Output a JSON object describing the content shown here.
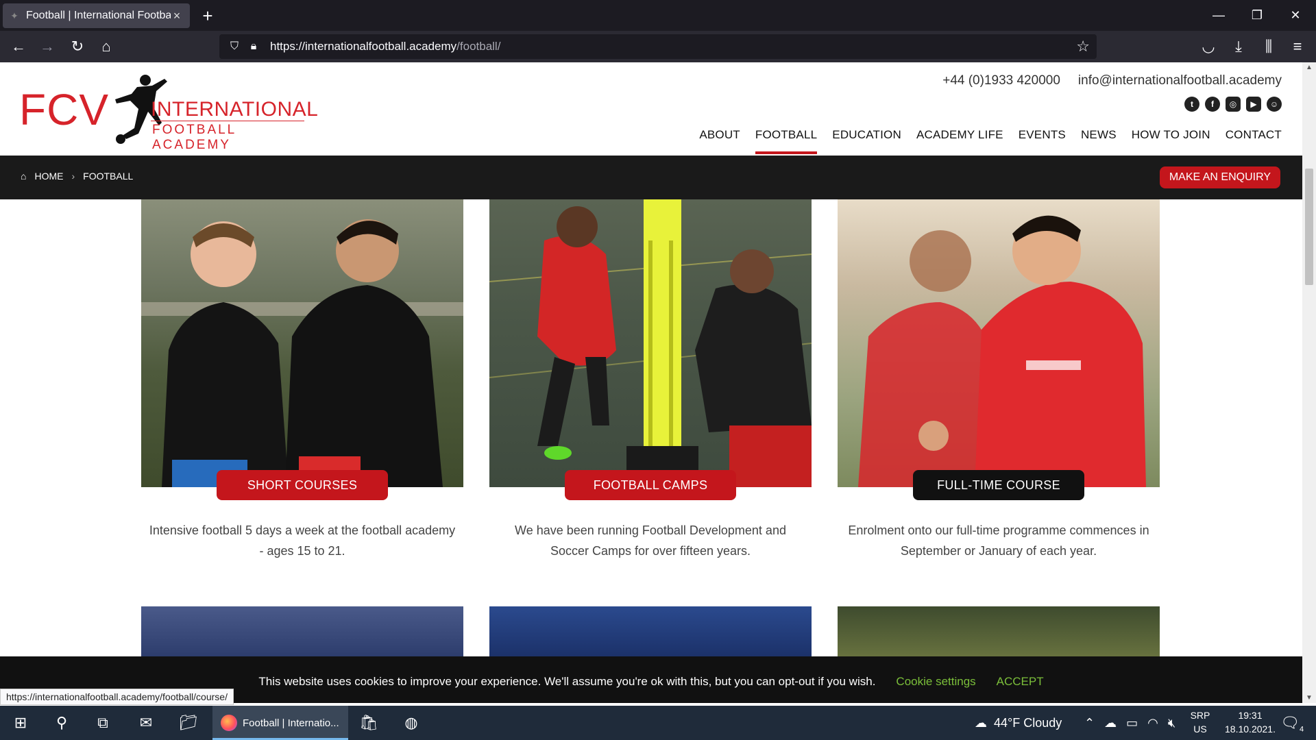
{
  "browser": {
    "tab_title": "Football | International Football",
    "new_tab": "+",
    "url_host": "https://internationalfootball.academy",
    "url_path": "/football/",
    "status_url": "https://internationalfootball.academy/football/course/"
  },
  "site": {
    "logo": {
      "fcv": "FCV",
      "line1": "INTERNATIONAL",
      "line2": "FOOTBALL ACADEMY"
    },
    "phone": "+44 (0)1933 420000",
    "email": "info@internationalfootball.academy",
    "socials": [
      "twitter-icon",
      "facebook-icon",
      "instagram-icon",
      "youtube-icon",
      "snapchat-icon"
    ],
    "nav": [
      "ABOUT",
      "FOOTBALL",
      "EDUCATION",
      "ACADEMY LIFE",
      "EVENTS",
      "NEWS",
      "HOW TO JOIN",
      "CONTACT"
    ],
    "nav_active": "FOOTBALL",
    "breadcrumb": {
      "home": "HOME",
      "sep": "›",
      "current": "FOOTBALL"
    },
    "enquiry": "MAKE AN ENQUIRY",
    "accent": "#c4161c"
  },
  "cards": [
    {
      "button": "SHORT COURSES",
      "desc": "Intensive football 5 days a week at the football academy - ages 15 to 21."
    },
    {
      "button": "FOOTBALL CAMPS",
      "desc": "We have been running Football Development and Soccer Camps for over fifteen years."
    },
    {
      "button": "FULL-TIME COURSE",
      "desc": "Enrolment onto our full-time programme commences in September or January of each year."
    }
  ],
  "cookie": {
    "message": "This website uses cookies to improve your experience. We'll assume you're ok with this, but you can opt-out if you wish.",
    "settings": "Cookie settings",
    "accept": "ACCEPT"
  },
  "taskbar": {
    "app_label": "Football | Internatio...",
    "weather": "44°F  Cloudy",
    "lang1": "SRP",
    "lang2": "US",
    "time": "19:31",
    "date": "18.10.2021.",
    "notifications": "4"
  }
}
